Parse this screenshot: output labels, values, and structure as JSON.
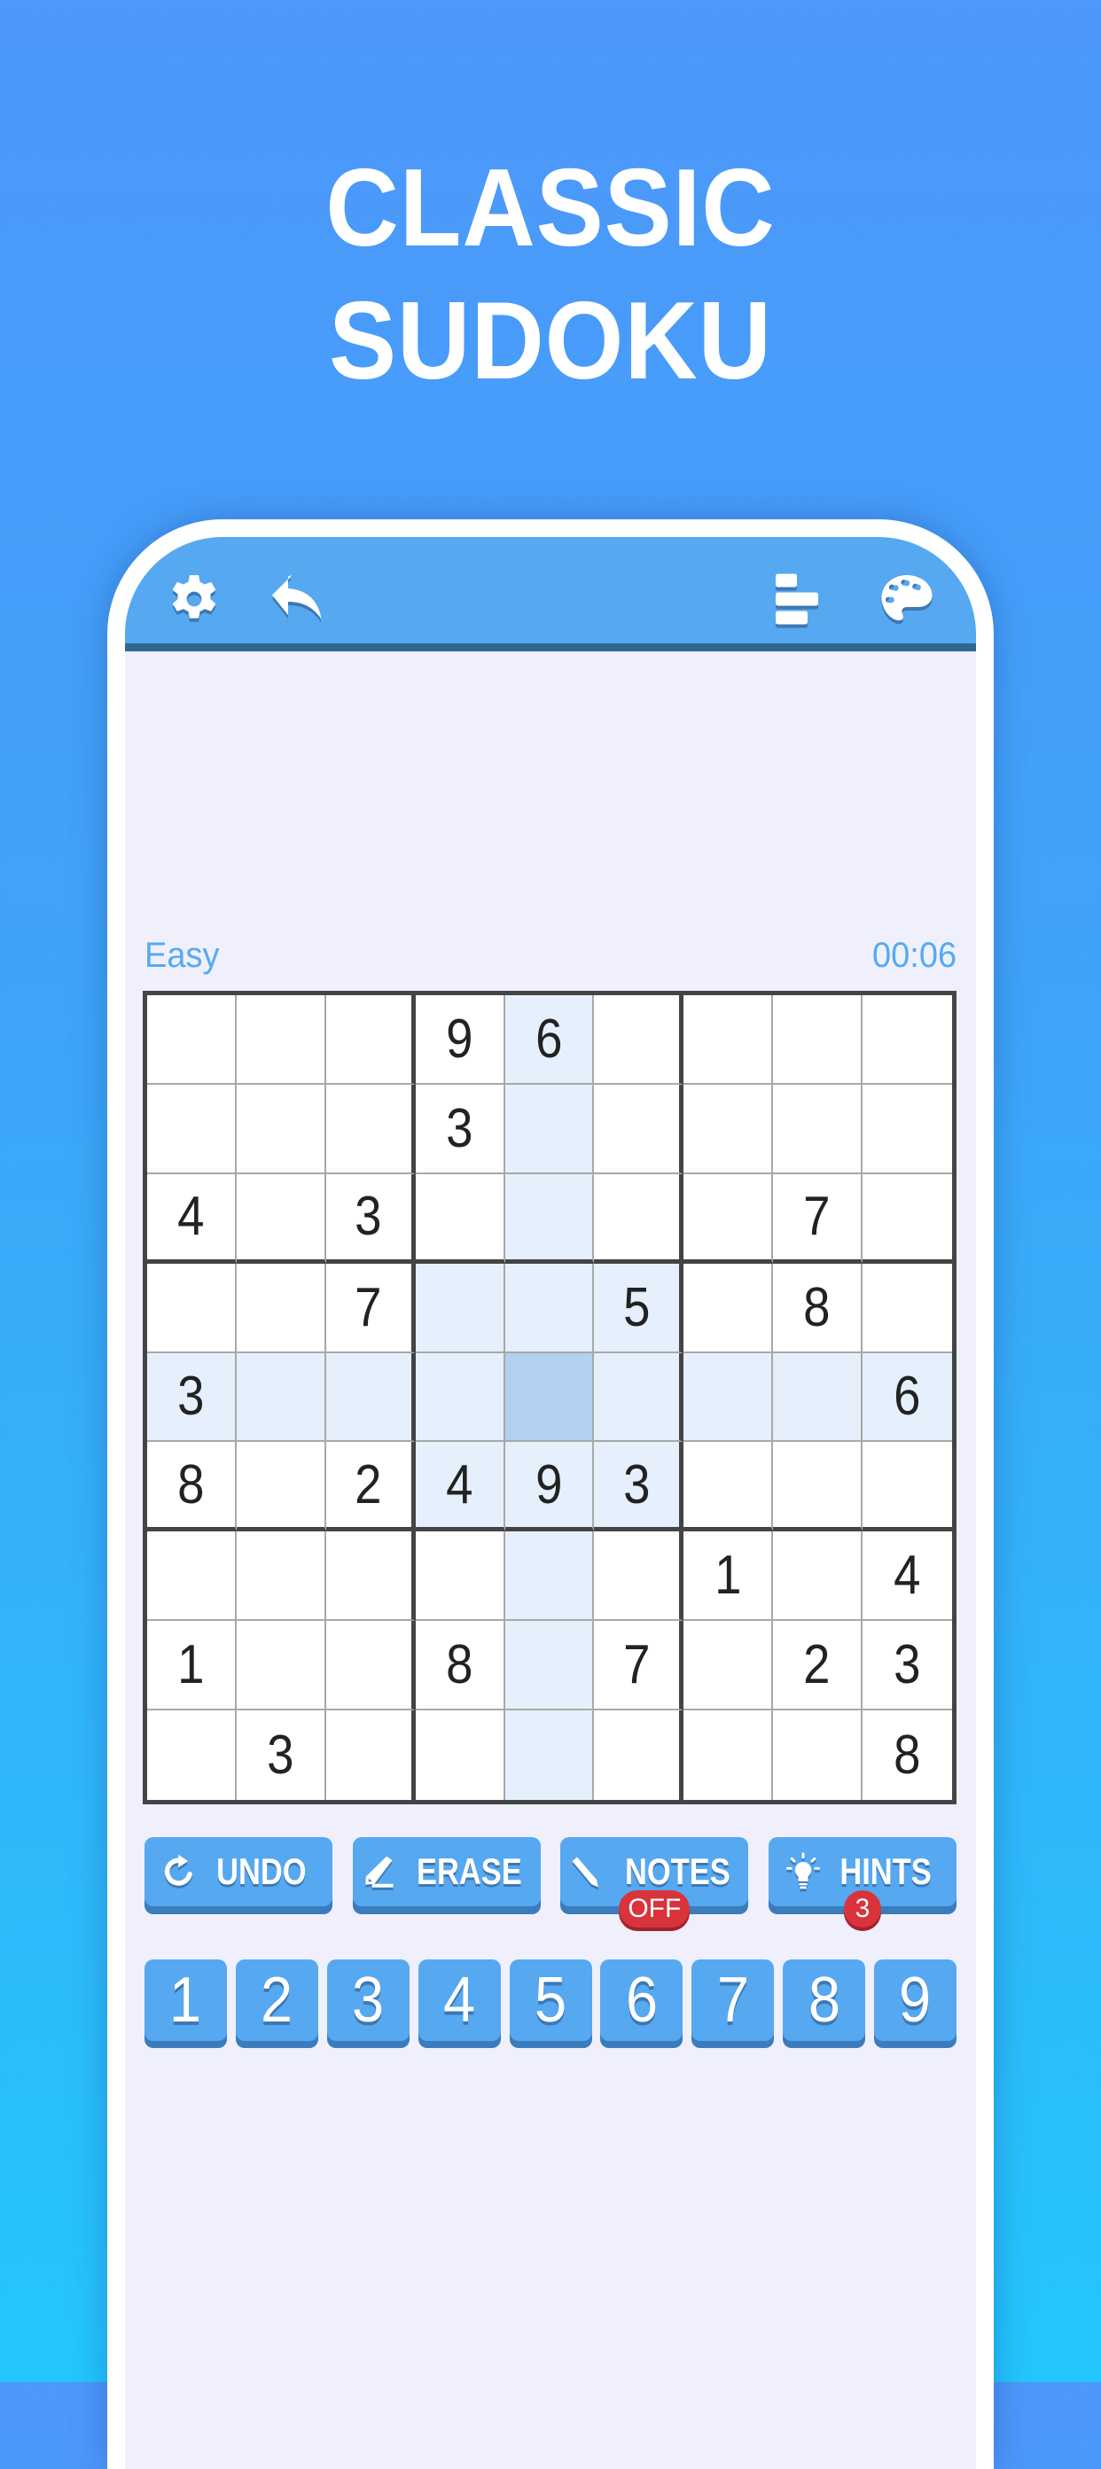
{
  "headline": {
    "line1": "CLASSIC",
    "line2": "SUDOKU"
  },
  "appbar": {
    "left_icons": [
      "gear-icon",
      "undo-arrow-icon"
    ],
    "right_icons": [
      "stats-bars-icon",
      "palette-icon"
    ]
  },
  "game": {
    "difficulty": "Easy",
    "timer": "00:06",
    "selected_cell": {
      "row": 5,
      "col": 5
    },
    "grid": [
      [
        "",
        "",
        "",
        "9",
        "6",
        "",
        "",
        "",
        ""
      ],
      [
        "",
        "",
        "",
        "3",
        "",
        "",
        "",
        "",
        ""
      ],
      [
        "4",
        "",
        "3",
        "",
        "",
        "",
        "",
        "7",
        ""
      ],
      [
        "",
        "",
        "7",
        "",
        "",
        "5",
        "",
        "8",
        ""
      ],
      [
        "3",
        "",
        "",
        "",
        "",
        "",
        "",
        "",
        "6"
      ],
      [
        "8",
        "",
        "2",
        "4",
        "9",
        "3",
        "",
        "",
        ""
      ],
      [
        "",
        "",
        "",
        "",
        "",
        "",
        "1",
        "",
        "4"
      ],
      [
        "1",
        "",
        "",
        "8",
        "",
        "7",
        "",
        "2",
        "3"
      ],
      [
        "",
        "3",
        "",
        "",
        "",
        "",
        "",
        "",
        "8"
      ]
    ]
  },
  "actions": {
    "undo": {
      "label": "UNDO",
      "icon": "rotate-arrow-icon"
    },
    "erase": {
      "label": "ERASE",
      "icon": "eraser-icon"
    },
    "notes": {
      "label": "NOTES",
      "icon": "pencil-icon",
      "badge": "OFF"
    },
    "hints": {
      "label": "HINTS",
      "icon": "lightbulb-icon",
      "badge": "3"
    }
  },
  "numpad": [
    "1",
    "2",
    "3",
    "4",
    "5",
    "6",
    "7",
    "8",
    "9"
  ],
  "colors": {
    "accent": "#56a8f0",
    "appbar_border": "#33668f",
    "badge_red": "#d9333c",
    "highlight": "#e6f0fd",
    "selected": "#b2d0f0",
    "screen_bg": "#eff0fc"
  }
}
